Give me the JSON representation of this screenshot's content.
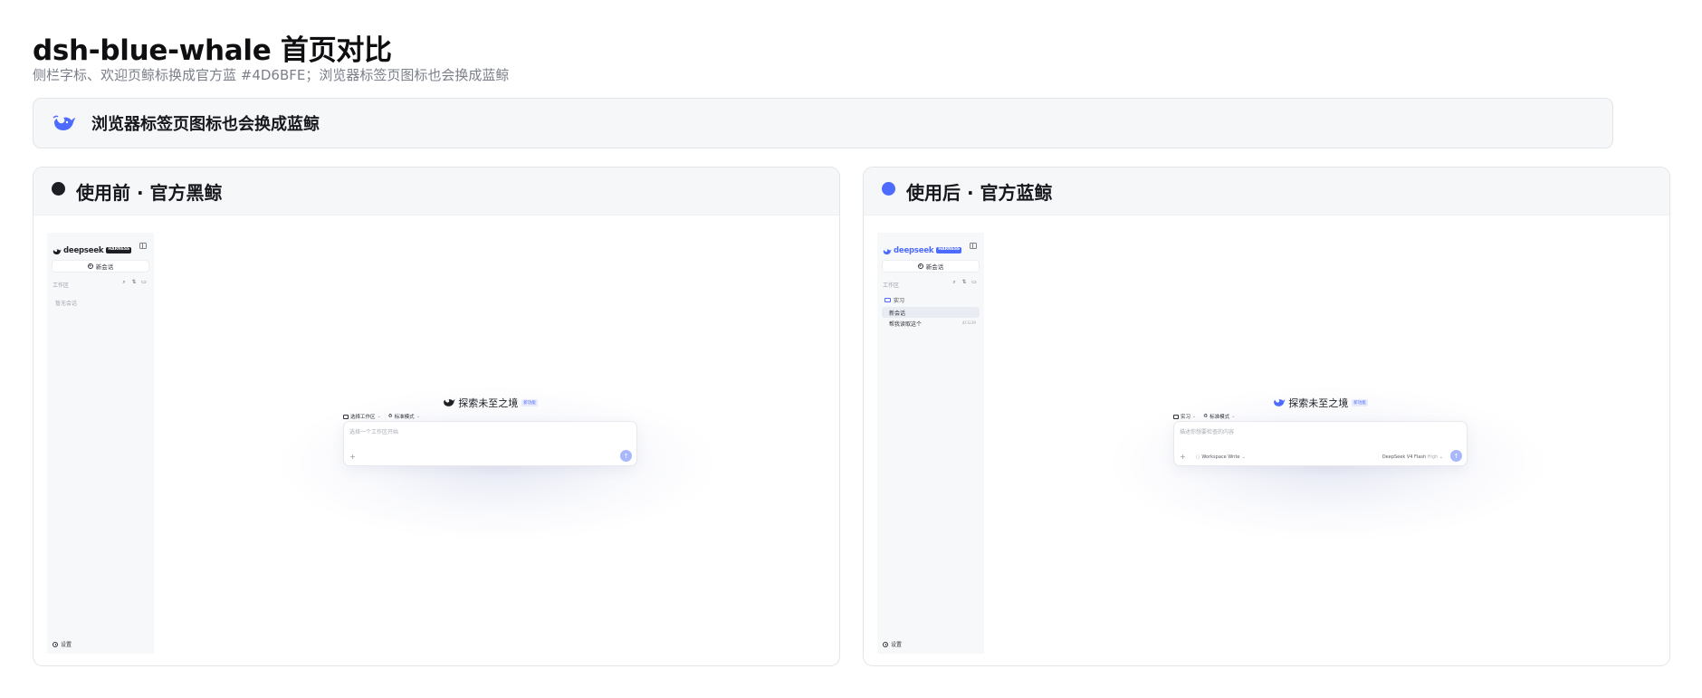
{
  "page": {
    "title": "dsh-blue-whale 首页对比",
    "subtitle": "侧栏字标、欢迎页鲸标换成官方蓝 #4D6BFE；浏览器标签页图标也会换成蓝鲸"
  },
  "banner": {
    "text": "浏览器标签页图标也会换成蓝鲸",
    "icon": "whale-icon",
    "color": "#4D6BFE"
  },
  "colors": {
    "official_blue": "#4D6BFE",
    "official_black": "#1d1f24"
  },
  "panels": [
    {
      "title": "使用前 · 官方黑鲸",
      "dot_color": "#1d1f24",
      "screenshot": {
        "logo_text": "deepseek",
        "logo_badge": "HARNESS",
        "new_chat": "新会话",
        "workspace_label": "工作区",
        "empty_text": "暂无会话",
        "settings": "设置",
        "welcome": "探索未至之境",
        "welcome_badge": "新功能",
        "chip_workspace": "选择工作区",
        "chip_mode": "标准模式",
        "placeholder": "选择一个工作区开始"
      }
    },
    {
      "title": "使用后 · 官方蓝鲸",
      "dot_color": "#4D6BFE",
      "screenshot": {
        "logo_text": "deepseek",
        "logo_badge": "HARNESS",
        "new_chat": "新会话",
        "workspace_label": "工作区",
        "folder": "实习",
        "items": [
          {
            "label": "新会话",
            "time": ""
          },
          {
            "label": "帮我读取这个",
            "time": "4CG39"
          }
        ],
        "settings": "设置",
        "welcome": "探索未至之境",
        "welcome_badge": "新功能",
        "chip_workspace": "实习",
        "chip_mode": "标准模式",
        "placeholder": "描述你想要检查的内容",
        "workspace_write": "Workspace Write",
        "model": "DeepSeek V4 Flash",
        "level": "High"
      }
    }
  ]
}
